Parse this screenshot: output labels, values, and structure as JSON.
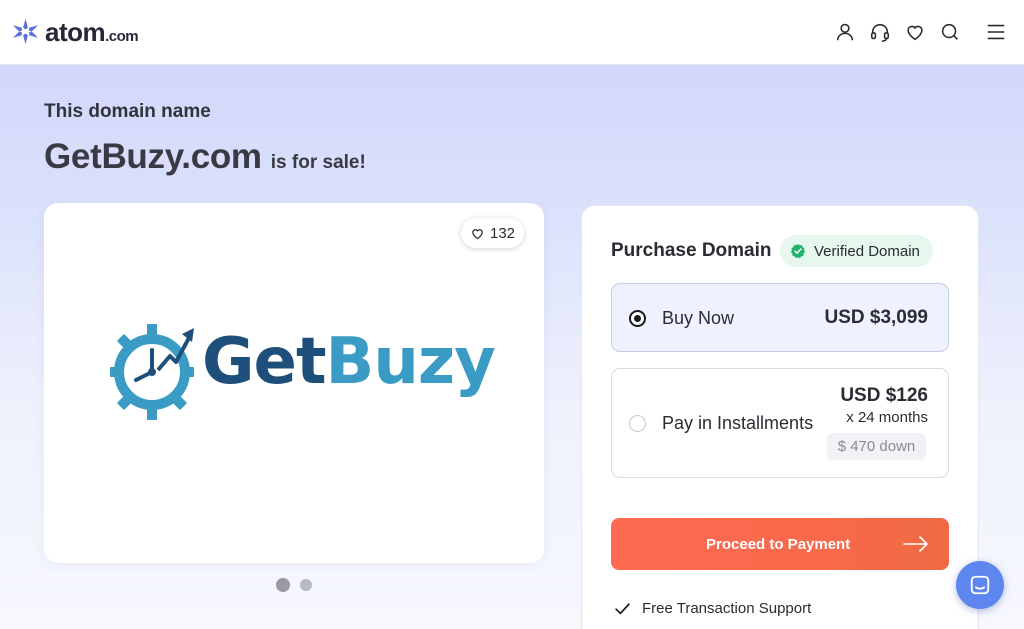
{
  "header": {
    "logo_text": "atom",
    "logo_suffix": ".com",
    "icons": [
      "user-icon",
      "headset-icon",
      "heart-icon",
      "search-icon",
      "menu-icon"
    ]
  },
  "hero": {
    "eyebrow": "This domain name",
    "domain": "GetBuzy.com",
    "for_sale": "is for sale!"
  },
  "domain_logo": {
    "brand_part1": "Get",
    "brand_part2": "Buzy"
  },
  "favorites": {
    "count": "132"
  },
  "carousel": {
    "total_slides": 2,
    "active_slide": 1
  },
  "purchase": {
    "title": "Purchase Domain",
    "verified_label": "Verified Domain",
    "options": [
      {
        "label": "Buy Now",
        "price": "USD $3,099",
        "selected": true
      },
      {
        "label": "Pay in Installments",
        "price": "USD $126",
        "term": "x 24 months",
        "down": "$ 470 down",
        "selected": false
      }
    ],
    "cta_label": "Proceed to Payment",
    "features": [
      "Free Transaction Support"
    ]
  },
  "colors": {
    "accent_orange": "#f96a4c",
    "verified_green": "#21b26b",
    "brand_dark_blue": "#1d4f7a",
    "brand_light_blue": "#3a9cc4",
    "chat_blue": "#5d86ee"
  }
}
